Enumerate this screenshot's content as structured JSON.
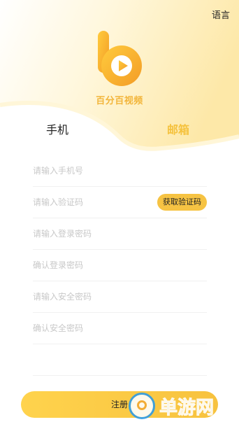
{
  "header": {
    "language_label": "语言"
  },
  "brand": {
    "name": "百分百视频"
  },
  "tabs": [
    {
      "label": "手机",
      "active": false
    },
    {
      "label": "邮箱",
      "active": true
    }
  ],
  "form": {
    "phone_placeholder": "请输入手机号",
    "code_placeholder": "请输入验证码",
    "get_code_label": "获取验证码",
    "login_password_placeholder": "请输入登录密码",
    "confirm_login_password_placeholder": "确认登录密码",
    "safe_password_placeholder": "请输入安全密码",
    "confirm_safe_password_placeholder": "确认安全密码"
  },
  "register_label": "注册",
  "watermark": {
    "text": "单游网"
  },
  "colors": {
    "accent": "#f6c343",
    "accent_text": "#f5c23e",
    "watermark_blue": "#2e9be6"
  }
}
